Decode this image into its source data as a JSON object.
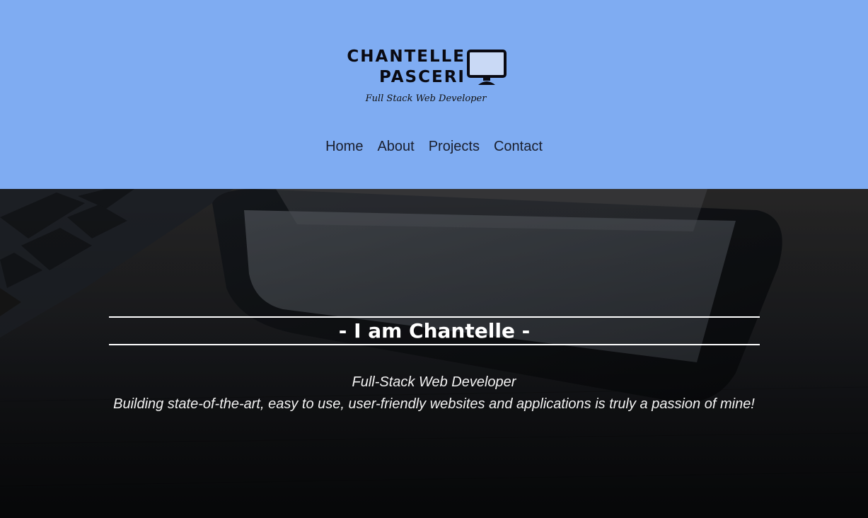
{
  "brand": {
    "name_line1": "CHANTELLE",
    "name_line2": "PASCERI",
    "tagline": "Full Stack Web Developer",
    "logo_icon": "monitor-icon"
  },
  "nav": {
    "items": [
      {
        "label": "Home"
      },
      {
        "label": "About"
      },
      {
        "label": "Projects"
      },
      {
        "label": "Contact"
      }
    ]
  },
  "hero": {
    "title": "- I am Chantelle -",
    "subtitle": "Full-Stack Web Developer",
    "description": "Building state-of-the-art, easy to use, user-friendly websites and applications is truly a passion of mine!",
    "background_image": "laptop-and-tablet-photo"
  },
  "colors": {
    "header_bg": "#7facf2",
    "hero_text": "#ffffff",
    "nav_text": "#1a1f2e"
  }
}
